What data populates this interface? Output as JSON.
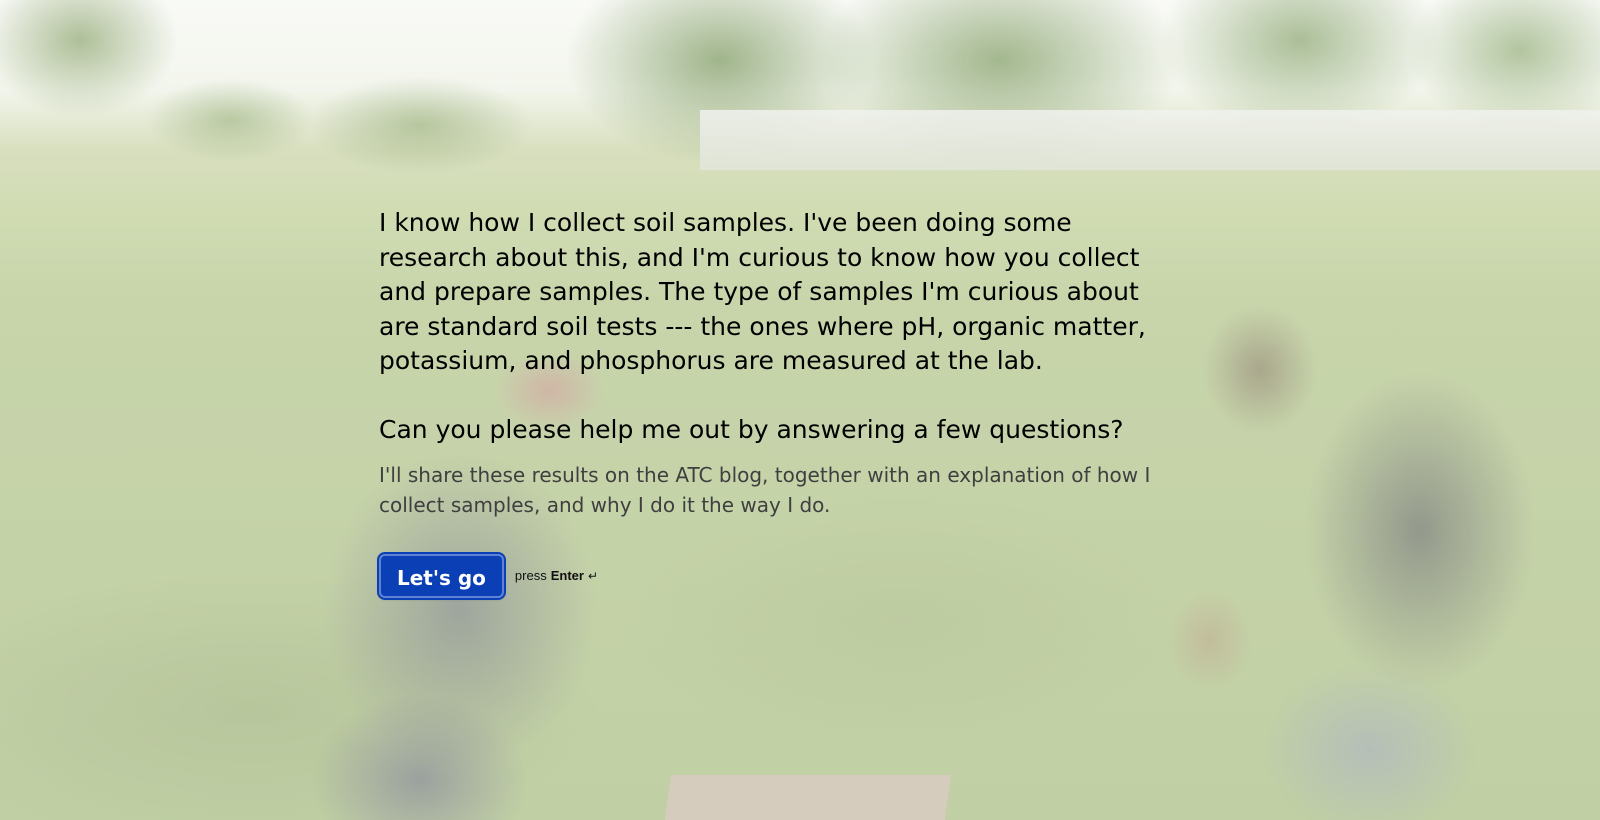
{
  "background": {
    "scene": "golf-course-photo",
    "accent_color": "#0a3fb6"
  },
  "intro": {
    "paragraph": "I know how I collect soil samples. I've been doing some research about this, and I'm curious to know how you collect and prepare samples. The type of samples I'm curious about are standard soil tests --- the ones where pH, organic matter, potassium, and phosphorus are measured at the lab.\n\nCan you please help me out by answering a few questions?",
    "description": "I'll share these results on the ATC blog, together with an explanation of how I collect samples, and why I do it the way I do."
  },
  "action": {
    "button_label": "Let's go",
    "hint_prefix": "press",
    "hint_key": "Enter",
    "hint_icon": "↵"
  }
}
